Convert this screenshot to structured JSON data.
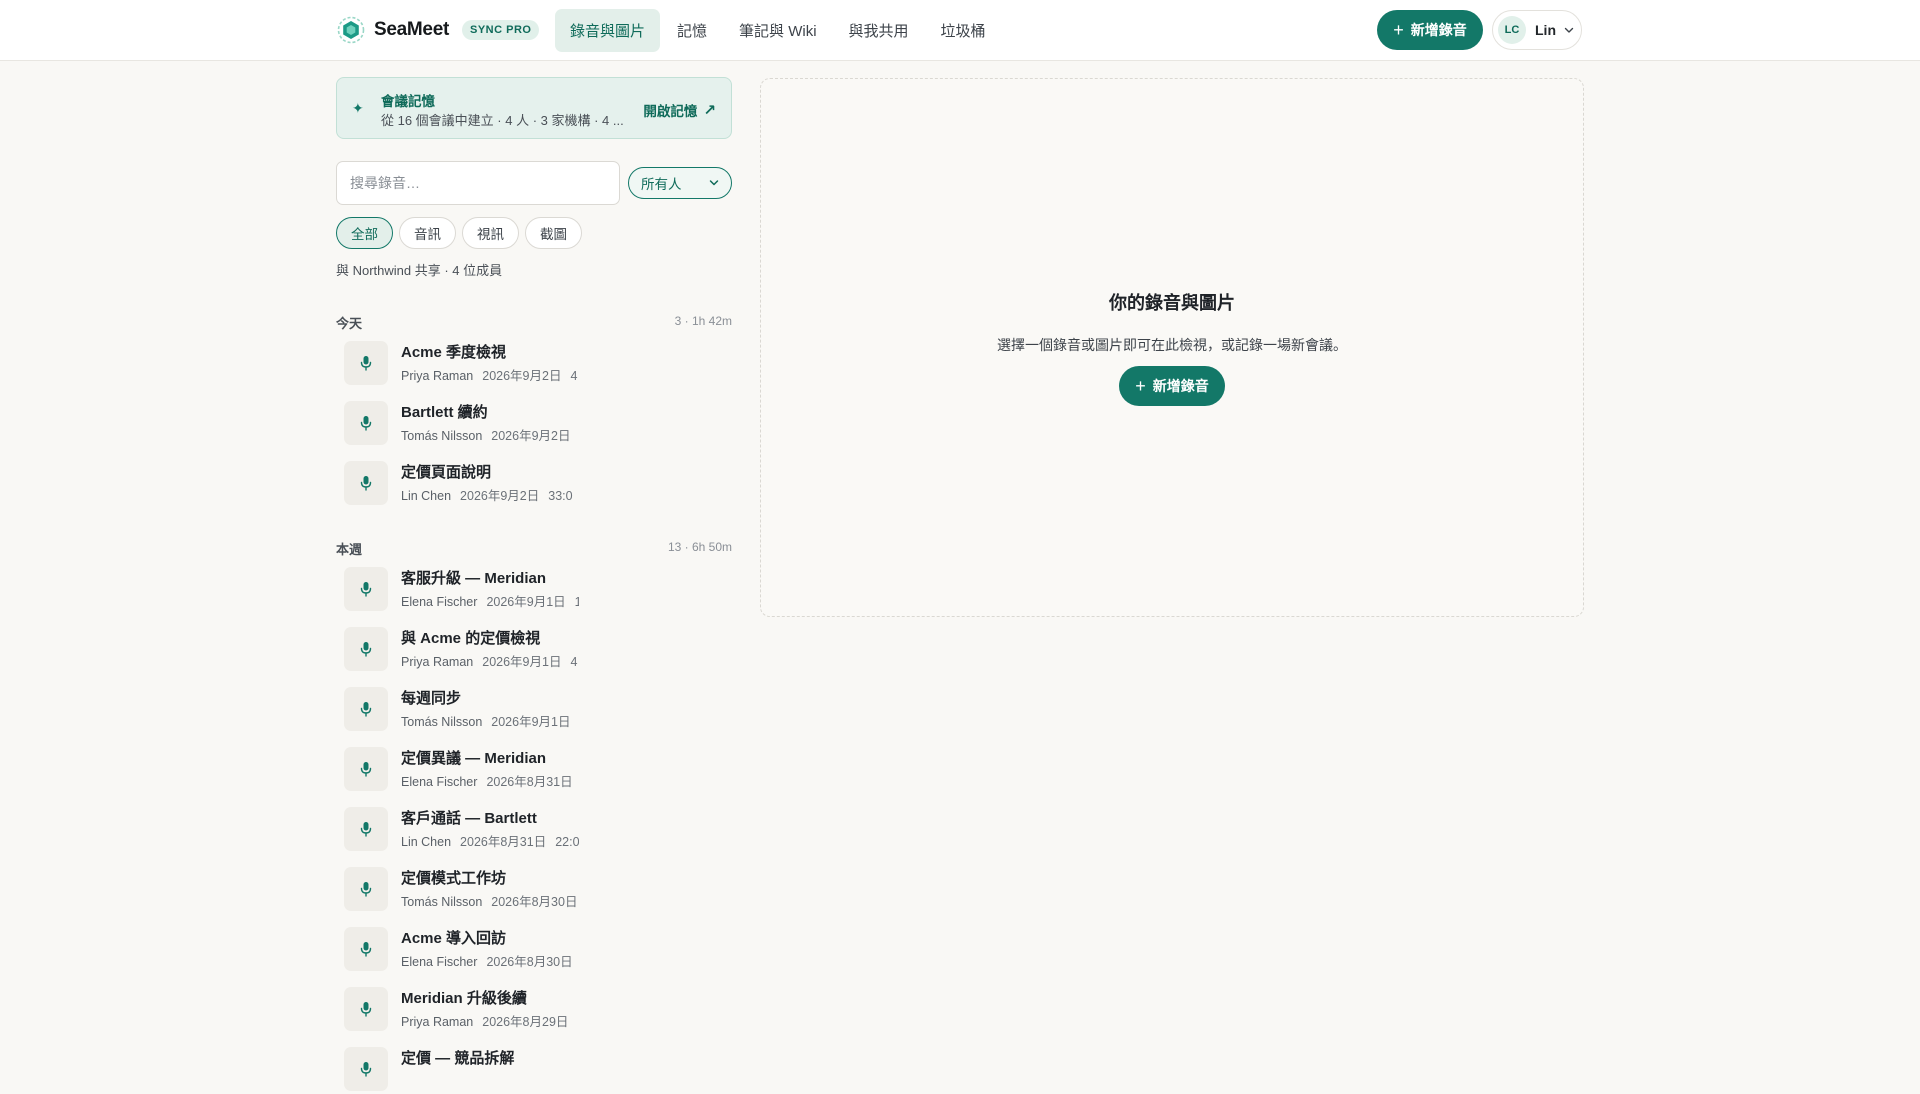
{
  "brand": {
    "name": "SeaMeet",
    "badge": "SYNC PRO",
    "accent": "#137868"
  },
  "nav": {
    "tabs": [
      {
        "label": "錄音與圖片",
        "active": true
      },
      {
        "label": "記憶"
      },
      {
        "label": "筆記與 Wiki"
      },
      {
        "label": "與我共用"
      },
      {
        "label": "垃圾桶"
      }
    ]
  },
  "header": {
    "new_recording": "新增錄音",
    "user_initials": "LC",
    "user_name": "Lin"
  },
  "memory": {
    "icon": "sparkle-icon",
    "title": "會議記憶",
    "subtitle": "從 16 個會議中建立 · 4 人 · 3 家機構 · 4 ...",
    "open_label": "開啟記憶"
  },
  "search": {
    "placeholder": "搜尋錄音…"
  },
  "owner_filter": {
    "selected": "所有人"
  },
  "type_filters": [
    {
      "label": "全部",
      "active": true
    },
    {
      "label": "音訊"
    },
    {
      "label": "視訊"
    },
    {
      "label": "截圖"
    }
  ],
  "share_info": "與 Northwind 共享 · 4 位成員",
  "sections": [
    {
      "title": "今天",
      "meta": "3 · 1h 42m",
      "items": [
        {
          "title": "Acme 季度檢視",
          "owner": "Priya Raman",
          "date": "2026年9月2日",
          "extra": "4"
        },
        {
          "title": "Bartlett 續約",
          "owner": "Tomás Nilsson",
          "date": "2026年9月2日",
          "extra": ""
        },
        {
          "title": "定價頁面說明",
          "owner": "Lin Chen",
          "date": "2026年9月2日",
          "extra": "33:0"
        }
      ]
    },
    {
      "title": "本週",
      "meta": "13 · 6h 50m",
      "items": [
        {
          "title": "客服升級 — Meridian",
          "owner": "Elena Fischer",
          "date": "2026年9月1日",
          "extra": "1"
        },
        {
          "title": "與 Acme 的定價檢視",
          "owner": "Priya Raman",
          "date": "2026年9月1日",
          "extra": "4"
        },
        {
          "title": "每週同步",
          "owner": "Tomás Nilsson",
          "date": "2026年9月1日",
          "extra": ""
        },
        {
          "title": "定價異議 — Meridian",
          "owner": "Elena Fischer",
          "date": "2026年8月31日",
          "extra": ""
        },
        {
          "title": "客戶通話 — Bartlett",
          "owner": "Lin Chen",
          "date": "2026年8月31日",
          "extra": "22:0"
        },
        {
          "title": "定價模式工作坊",
          "owner": "Tomás Nilsson",
          "date": "2026年8月30日",
          "extra": ""
        },
        {
          "title": "Acme 導入回訪",
          "owner": "Elena Fischer",
          "date": "2026年8月30日",
          "extra": ""
        },
        {
          "title": "Meridian 升級後續",
          "owner": "Priya Raman",
          "date": "2026年8月29日",
          "extra": ""
        },
        {
          "title": "定價 — 競品拆解",
          "owner": "",
          "date": "",
          "extra": ""
        }
      ]
    }
  ],
  "empty_state": {
    "title": "你的錄音與圖片",
    "description": "選擇一個錄音或圖片即可在此檢視，或記錄一場新會議。",
    "button": "新增錄音"
  }
}
